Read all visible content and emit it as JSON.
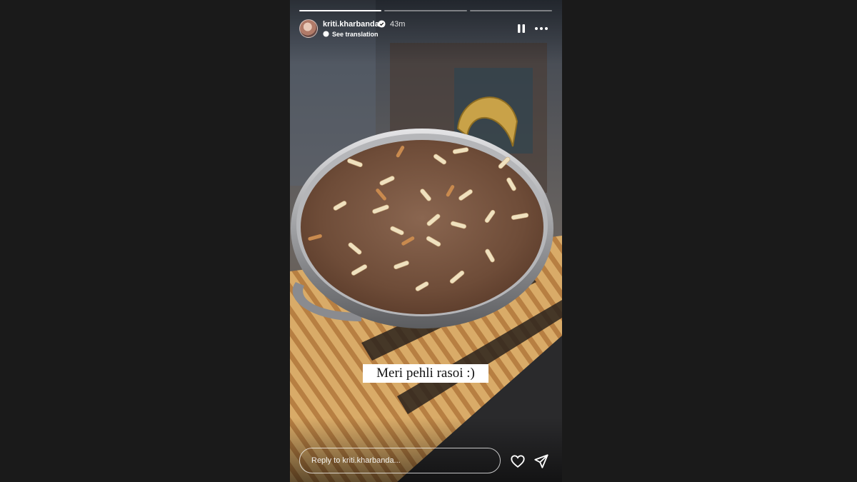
{
  "story": {
    "username": "kriti.kharbanda",
    "time_ago": "43m",
    "translation_link": "See translation",
    "caption": "Meri pehli rasoi :)",
    "progress": [
      1.0,
      0.0,
      0.0
    ]
  },
  "reply": {
    "placeholder": "Reply to kriti.kharbanda..."
  },
  "icons": {
    "verified": "verified-badge-icon",
    "pause": "pause-icon",
    "more": "more-options-icon",
    "like": "heart-icon",
    "share": "send-icon"
  },
  "colors": {
    "background": "#1a1a1a",
    "verified": "#ffffff",
    "caption_bg": "#ffffff"
  }
}
